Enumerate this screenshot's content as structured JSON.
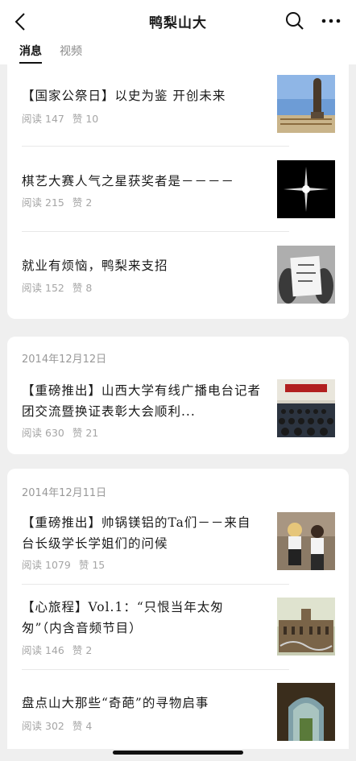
{
  "header": {
    "title": "鸭梨山大",
    "tabs": [
      {
        "label": "消息",
        "active": true
      },
      {
        "label": "视频",
        "active": false
      }
    ]
  },
  "groups": [
    {
      "date": "",
      "articles": [
        {
          "title": "【国家公祭日】以史为鉴 开创未来",
          "read_label": "阅读",
          "read": "147",
          "like_label": "赞",
          "likes": "10",
          "thumb": "statue-image"
        },
        {
          "title": "棋艺大赛人气之星获奖者是－－－－",
          "read_label": "阅读",
          "read": "215",
          "like_label": "赞",
          "likes": "2",
          "thumb": "sparkle-image"
        },
        {
          "title": "就业有烦恼，鸭梨来支招",
          "read_label": "阅读",
          "read": "152",
          "like_label": "赞",
          "likes": "8",
          "thumb": "paper-sign-image"
        }
      ]
    },
    {
      "date": "2014年12月12日",
      "articles": [
        {
          "title": "【重磅推出】山西大学有线广播电台记者团交流暨换证表彰大会顺利...",
          "read_label": "阅读",
          "read": "630",
          "like_label": "赞",
          "likes": "21",
          "thumb": "auditorium-image"
        }
      ]
    },
    {
      "date": "2014年12月11日",
      "articles": [
        {
          "title": "【重磅推出】帅锅镁铝的Ta们－－来自台长级学长学姐们的问候",
          "read_label": "阅读",
          "read": "1079",
          "like_label": "赞",
          "likes": "15",
          "thumb": "group-photo-image"
        },
        {
          "title": "【心旅程】Vol.1：“只恨当年太匆匆”（内含音频节目）",
          "read_label": "阅读",
          "read": "146",
          "like_label": "赞",
          "likes": "2",
          "thumb": "building-image"
        },
        {
          "title": "盘点山大那些“奇葩”的寻物启事",
          "read_label": "阅读",
          "read": "302",
          "like_label": "赞",
          "likes": "4",
          "thumb": "tunnel-image"
        }
      ]
    }
  ]
}
